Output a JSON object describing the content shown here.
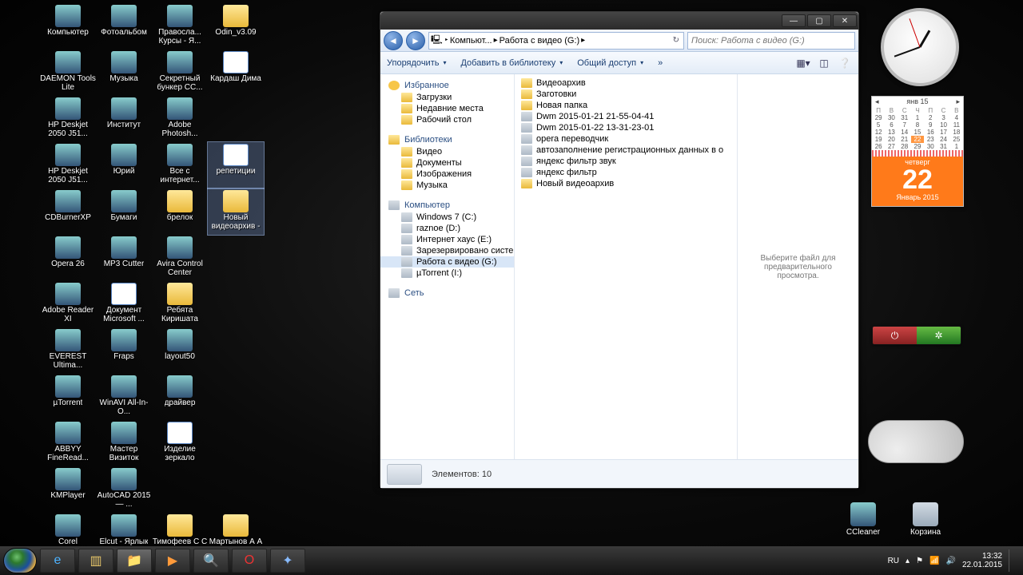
{
  "desktopIcons": [
    [
      "Компьютер",
      "exe"
    ],
    [
      "Фотоальбом",
      "exe"
    ],
    [
      "Правосла... Курсы - Я...",
      "exe"
    ],
    [
      "Odin_v3.09",
      "folder"
    ],
    [
      "DAEMON Tools Lite",
      "exe"
    ],
    [
      "Музыка",
      "exe"
    ],
    [
      "Секретный бункер СС...",
      "exe"
    ],
    [
      "Кардаш Дима",
      "doc"
    ],
    [
      "HP Deskjet 2050 J51...",
      "exe"
    ],
    [
      "Институт",
      "exe"
    ],
    [
      "Adobe Photosh...",
      "exe"
    ],
    [
      "",
      ""
    ],
    [
      "HP Deskjet 2050 J51...",
      "exe"
    ],
    [
      "Юрий",
      "exe"
    ],
    [
      "Все с интернет...",
      "exe"
    ],
    [
      "репетиции",
      "doc"
    ],
    [
      "CDBurnerXP",
      "exe"
    ],
    [
      "Бумаги",
      "exe"
    ],
    [
      "брелок",
      "folder"
    ],
    [
      "Новый видеоархив - Ярлык",
      "folder"
    ],
    [
      "Opera 26",
      "exe"
    ],
    [
      "MP3 Cutter",
      "exe"
    ],
    [
      "Avira Control Center",
      "exe"
    ],
    [
      "",
      ""
    ],
    [
      "Adobe Reader XI",
      "exe"
    ],
    [
      "Документ Microsoft ...",
      "doc"
    ],
    [
      "Ребята Киришата",
      "folder"
    ],
    [
      "",
      ""
    ],
    [
      "EVEREST Ultima...",
      "exe"
    ],
    [
      "Fraps",
      "exe"
    ],
    [
      "layout50",
      "exe"
    ],
    [
      "",
      ""
    ],
    [
      "µTorrent",
      "exe"
    ],
    [
      "WinAVI All-In-O...",
      "exe"
    ],
    [
      "драйвер",
      "exe"
    ],
    [
      "",
      ""
    ],
    [
      "ABBYY FineRead...",
      "exe"
    ],
    [
      "Мастер Визиток",
      "exe"
    ],
    [
      "Изделие зеркало",
      "doc"
    ],
    [
      "",
      ""
    ],
    [
      "KMPlayer",
      "exe"
    ],
    [
      "AutoCAD 2015 — ...",
      "exe"
    ],
    [
      "",
      ""
    ],
    [
      "",
      ""
    ],
    [
      "Corel VideoStud...",
      "exe"
    ],
    [
      "Elcut - Ярлык",
      "exe"
    ],
    [
      "Тимофеев С С",
      "folder"
    ],
    [
      "Мартынов А А - Ярлык",
      "folder"
    ]
  ],
  "selectedIcons": [
    15,
    19
  ],
  "breadcrumb": [
    "Компьют...",
    "Работа с видео (G:)"
  ],
  "searchPlaceholder": "Поиск: Работа с видео (G:)",
  "toolbar": {
    "organize": "Упорядочить",
    "library": "Добавить в библиотеку",
    "share": "Общий доступ",
    "more": "»"
  },
  "nav": {
    "favorites": {
      "hdr": "Избранное",
      "items": [
        "Загрузки",
        "Недавние места",
        "Рабочий стол"
      ]
    },
    "libraries": {
      "hdr": "Библиотеки",
      "items": [
        "Видео",
        "Документы",
        "Изображения",
        "Музыка"
      ]
    },
    "computer": {
      "hdr": "Компьютер",
      "items": [
        "Windows 7 (C:)",
        "raznoe (D:)",
        "Интернет хаус (E:)",
        "Зарезервировано систем",
        "Работа с видео (G:)",
        "µTorrent (I:)"
      ],
      "selected": 4
    },
    "network": {
      "hdr": "Сеть"
    }
  },
  "files": [
    [
      "Видеоархив",
      "f"
    ],
    [
      "Заготовки",
      "f"
    ],
    [
      "Новая папка",
      "f"
    ],
    [
      "Dwm 2015-01-21 21-55-04-41",
      "d"
    ],
    [
      "Dwm 2015-01-22 13-31-23-01",
      "d"
    ],
    [
      "opera переводчик",
      "d"
    ],
    [
      "автозаполнение регистрационных данных в о",
      "d"
    ],
    [
      "яндекс фильтр звук",
      "d"
    ],
    [
      "яндекс фильтр",
      "d"
    ],
    [
      "Новый видеоархив",
      "f"
    ]
  ],
  "preview": "Выберите файл для предварительного просмотра.",
  "status": "Элементов: 10",
  "calendar": {
    "month": "янв 15",
    "dow": [
      "П",
      "В",
      "С",
      "Ч",
      "П",
      "С",
      "В"
    ],
    "days": [
      "29",
      "30",
      "31",
      "1",
      "2",
      "3",
      "4",
      "5",
      "6",
      "7",
      "8",
      "9",
      "10",
      "11",
      "12",
      "13",
      "14",
      "15",
      "16",
      "17",
      "18",
      "19",
      "20",
      "21",
      "22",
      "23",
      "24",
      "25",
      "26",
      "27",
      "28",
      "29",
      "30",
      "31",
      "1"
    ],
    "todayIndex": 24,
    "weekday": "четверг",
    "bigday": "22",
    "monthyear": "Январь 2015"
  },
  "rightIcons": {
    "ccleaner": "CCleaner",
    "trash": "Корзина"
  },
  "tray": {
    "lang": "RU",
    "time": "13:32",
    "date": "22.01.2015"
  }
}
